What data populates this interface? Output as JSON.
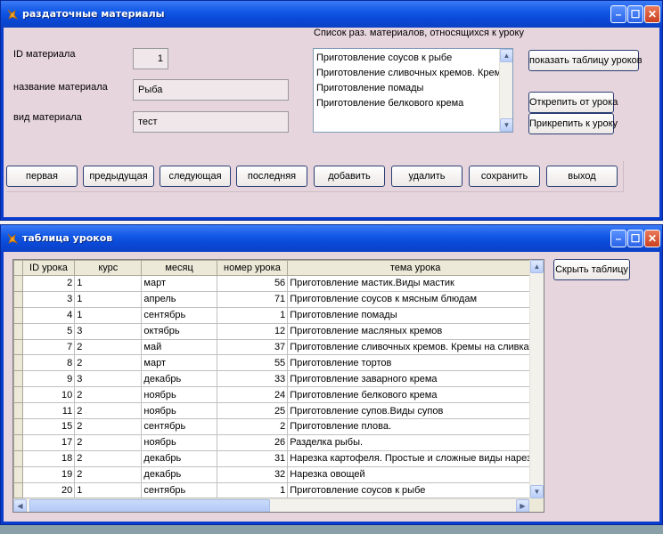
{
  "window1": {
    "title": "раздаточные материалы",
    "fields": {
      "id_label": "ID материала",
      "id_value": "1",
      "name_label": "название материала",
      "name_value": "Рыба",
      "type_label": "вид материала",
      "type_value": "тест"
    },
    "list_title": "Список раз. материалов, относящихся к уроку",
    "list_items": [
      "Приготовление соусов к рыбе",
      "Приготовление сливочных кремов. Кремы на сливках",
      "Приготовление помады",
      "Приготовление белкового крема"
    ],
    "buttons": {
      "show_lessons": "показать таблицу уроков",
      "detach": "Открепить от урока",
      "attach": "Прикрепить к уроку"
    },
    "nav": [
      "первая",
      "предыдущая",
      "следующая",
      "последняя",
      "добавить",
      "удалить",
      "сохранить",
      "выход"
    ]
  },
  "window2": {
    "title": "таблица уроков",
    "hide_button": "Скрыть таблицу",
    "columns": [
      "ID урока",
      "курс",
      "месяц",
      "номер урока",
      "тема урока"
    ],
    "rows": [
      [
        "2",
        "1",
        "март",
        "56",
        "Приготовление мастик.Виды мастик"
      ],
      [
        "3",
        "1",
        "апрель",
        "71",
        "Приготовление соусов к мясным блюдам"
      ],
      [
        "4",
        "1",
        "сентябрь",
        "1",
        "Приготовление помады"
      ],
      [
        "5",
        "3",
        "октябрь",
        "12",
        "Приготовление масляных кремов"
      ],
      [
        "7",
        "2",
        "май",
        "37",
        "Приготовление сливочных кремов. Кремы на сливках"
      ],
      [
        "8",
        "2",
        "март",
        "55",
        "Приготовление тортов"
      ],
      [
        "9",
        "3",
        "декабрь",
        "33",
        "Приготовление заварного крема"
      ],
      [
        "10",
        "2",
        "ноябрь",
        "24",
        "Приготовление белкового крема"
      ],
      [
        "11",
        "2",
        "ноябрь",
        "25",
        "Приготовление супов.Виды супов"
      ],
      [
        "15",
        "2",
        "сентябрь",
        "2",
        "Приготовление плова."
      ],
      [
        "17",
        "2",
        "ноябрь",
        "26",
        "Разделка рыбы."
      ],
      [
        "18",
        "2",
        "декабрь",
        "31",
        "Нарезка картофеля. Простые и сложные виды нарезки"
      ],
      [
        "19",
        "2",
        "декабрь",
        "32",
        "Нарезка овощей"
      ],
      [
        "20",
        "1",
        "сентябрь",
        "1",
        "Приготовление соусов к рыбе"
      ]
    ]
  },
  "colors": {
    "titlebar": "#0a48d6",
    "client_bg": "#e7d5dd",
    "frame": "#0a3ccf"
  },
  "icons": {
    "app": "fox-icon",
    "minimize": "minimize-icon",
    "maximize": "maximize-icon",
    "close": "close-icon"
  }
}
